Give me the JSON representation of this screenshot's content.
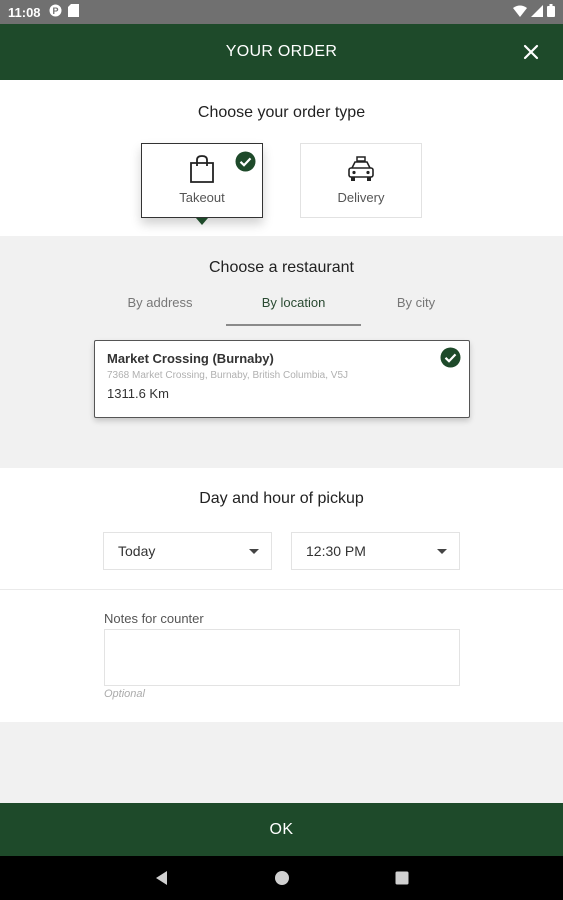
{
  "status_bar": {
    "time": "11:08",
    "icons": [
      "notification-p-icon",
      "sd-card-icon",
      "wifi-icon",
      "signal-icon",
      "battery-icon"
    ]
  },
  "header": {
    "title": "YOUR ORDER",
    "close_icon": "close-icon",
    "background": "#1e4a2a"
  },
  "order_type": {
    "heading": "Choose your order type",
    "options": [
      {
        "label": "Takeout",
        "icon": "shopping-bag-icon",
        "selected": true
      },
      {
        "label": "Delivery",
        "icon": "taxi-icon",
        "selected": false
      }
    ]
  },
  "restaurant": {
    "heading": "Choose a restaurant",
    "tabs": [
      {
        "label": "By address",
        "active": false
      },
      {
        "label": "By location",
        "active": true
      },
      {
        "label": "By city",
        "active": false
      }
    ],
    "selected": {
      "name": "Market Crossing (Burnaby)",
      "address": "7368 Market Crossing, Burnaby, British Columbia, V5J",
      "distance": "1311.6 Km"
    }
  },
  "pickup": {
    "heading": "Day and hour of pickup",
    "day": "Today",
    "hour": "12:30 PM"
  },
  "notes": {
    "label": "Notes for counter",
    "value": "",
    "hint": "Optional"
  },
  "footer": {
    "ok_label": "OK"
  },
  "colors": {
    "brand_green": "#1e4a2a",
    "section_grey": "#f1f1f1"
  }
}
